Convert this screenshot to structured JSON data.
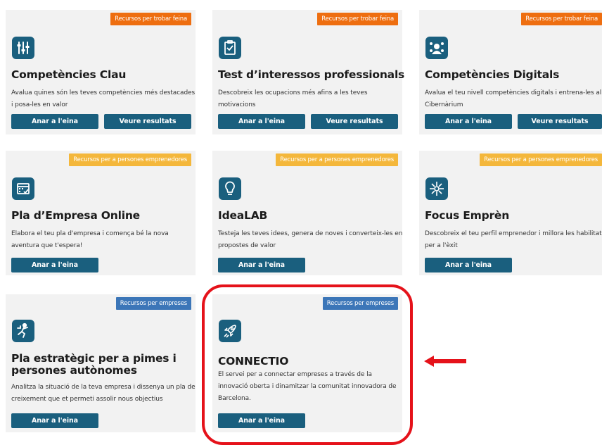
{
  "cards": [
    {
      "tag": "Recursos per trobar feina",
      "icon": "equalizer-icon",
      "title": "Competències Clau",
      "desc": "Avalua quines són les teves competències més destacades i posa-les en valor",
      "btn1": "Anar a l'eina",
      "btn2": "Veure resultats"
    },
    {
      "tag": "Recursos per trobar feina",
      "icon": "checklist-icon",
      "title": "Test d’interessos professionals",
      "desc": "Descobreix les ocupacions més afins a les teves motivacions",
      "btn1": "Anar a l'eina",
      "btn2": "Veure resultats"
    },
    {
      "tag": "Recursos per trobar feina",
      "icon": "network-user-icon",
      "title": "Competències Digitals",
      "desc": "Avalua el teu nivell competències digitals i entrena-les al Cibernàrium",
      "btn1": "Anar a l'eina",
      "btn2": "Veure resultats"
    },
    {
      "tag": "Recursos per a persones emprenedores",
      "icon": "calendar-check-icon",
      "title": "Pla d’Empresa Online",
      "desc": "Elabora el teu pla d'empresa i comença bé la nova aventura que t'espera!",
      "btn1": "Anar a l'eina"
    },
    {
      "tag": "Recursos per a persones emprenedores",
      "icon": "lightbulb-icon",
      "title": "IdeaLAB",
      "desc": "Testeja les teves idees, genera de noves i converteix-les en propostes de valor",
      "btn1": "Anar a l'eina"
    },
    {
      "tag": "Recursos per a persones emprenedores",
      "icon": "focus-burst-icon",
      "title": "Focus Emprèn",
      "desc": "Descobreix el teu perfil emprenedor i millora les habilitats per a l'èxit",
      "btn1": "Anar a l'eina"
    },
    {
      "tag": "Recursos per empreses",
      "icon": "climbing-person-icon",
      "title": "Pla estratègic per a pimes i persones autònomes",
      "desc": "Analitza la situació de la teva empresa i dissenya un pla de creixement que et permeti assolir nous objectius",
      "btn1": "Anar a l'eina"
    },
    {
      "tag": "Recursos per empreses",
      "icon": "rocket-icon",
      "title": "CONNECTIO",
      "desc": "El servei per a connectar empreses a través de la innovació oberta i dinamitzar la comunitat innovadora de Barcelona.",
      "btn1": "Anar a l'eina"
    }
  ],
  "colors": {
    "orange": "#ee6e10",
    "yellow": "#f4b73b",
    "blue": "#3c76b8",
    "button": "#1a5f7e",
    "highlight": "#e5121a"
  }
}
